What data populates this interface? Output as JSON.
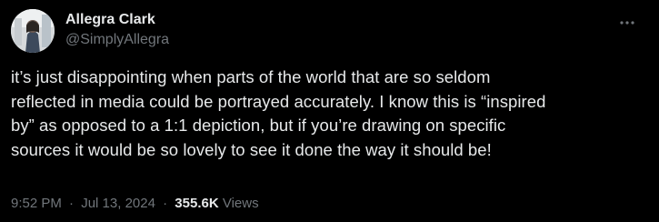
{
  "author": {
    "display_name": "Allegra Clark",
    "handle": "@SimplyAllegra"
  },
  "tweet": {
    "text": "it’s just disappointing when parts of the world that are so seldom\nreflected in media could be portrayed accurately. I know this is “inspired\nby” as opposed to a 1:1 depiction, but if you’re drawing on specific\nsources it would be so lovely to see it done the way it should be!",
    "time": "9:52 PM",
    "date": "Jul 13, 2024",
    "separator": "·",
    "views_count": "355.6K",
    "views_label": "Views"
  },
  "icons": {
    "more": "more-horizontal-icon",
    "avatar": "profile-photo"
  },
  "colors": {
    "background": "#000000",
    "primary_text": "#e7e9ea",
    "secondary_text": "#71767b"
  }
}
